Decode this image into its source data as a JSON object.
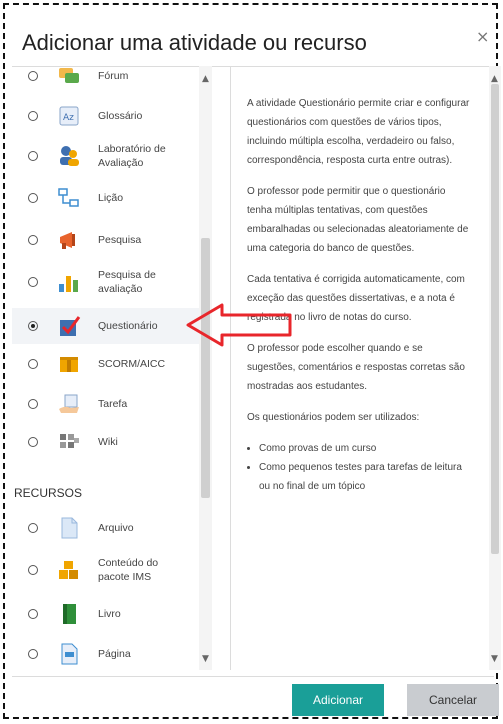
{
  "dialog": {
    "title": "Adicionar uma atividade ou recurso",
    "close_label": "×"
  },
  "activities": [
    {
      "label": "Fórum",
      "icon": "forum-icon",
      "selected": false
    },
    {
      "label": "Glossário",
      "icon": "glossary-icon",
      "selected": false
    },
    {
      "label": "Laboratório de Avaliação",
      "icon": "workshop-icon",
      "selected": false
    },
    {
      "label": "Lição",
      "icon": "lesson-icon",
      "selected": false
    },
    {
      "label": "Pesquisa",
      "icon": "survey-icon",
      "selected": false
    },
    {
      "label": "Pesquisa de avaliação",
      "icon": "feedback-icon",
      "selected": false
    },
    {
      "label": "Questionário",
      "icon": "quiz-icon",
      "selected": true
    },
    {
      "label": "SCORM/AICC",
      "icon": "scorm-icon",
      "selected": false
    },
    {
      "label": "Tarefa",
      "icon": "assignment-icon",
      "selected": false
    },
    {
      "label": "Wiki",
      "icon": "wiki-icon",
      "selected": false
    }
  ],
  "resources_heading": "RECURSOS",
  "resources": [
    {
      "label": "Arquivo",
      "icon": "file-icon",
      "selected": false
    },
    {
      "label": "Conteúdo do pacote IMS",
      "icon": "ims-package-icon",
      "selected": false
    },
    {
      "label": "Livro",
      "icon": "book-icon",
      "selected": false
    },
    {
      "label": "Página",
      "icon": "page-icon",
      "selected": false
    }
  ],
  "description": {
    "paragraphs": [
      "A atividade Questionário permite criar e configurar questionários com questões de vários tipos, incluindo múltipla escolha, verdadeiro ou falso, correspondência, resposta curta entre outras).",
      "O professor pode permitir que o questionário tenha múltiplas tentativas, com questões embaralhadas ou selecionadas aleatoriamente de uma categoria do banco de questões.",
      "Cada tentativa é corrigida automaticamente, com exceção das questões dissertativas, e a nota é registrada no livro de notas do curso.",
      "O professor pode escolher quando e se sugestões, comentários e respostas corretas são mostradas aos estudantes.",
      "Os questionários podem ser utilizados:"
    ],
    "bullets": [
      "Como provas de um curso",
      "Como pequenos testes para tarefas de leitura ou no final de um tópico"
    ]
  },
  "buttons": {
    "add": "Adicionar",
    "cancel": "Cancelar"
  },
  "colors": {
    "primary": "#1a9f98",
    "annotation_arrow": "#e8262b"
  }
}
